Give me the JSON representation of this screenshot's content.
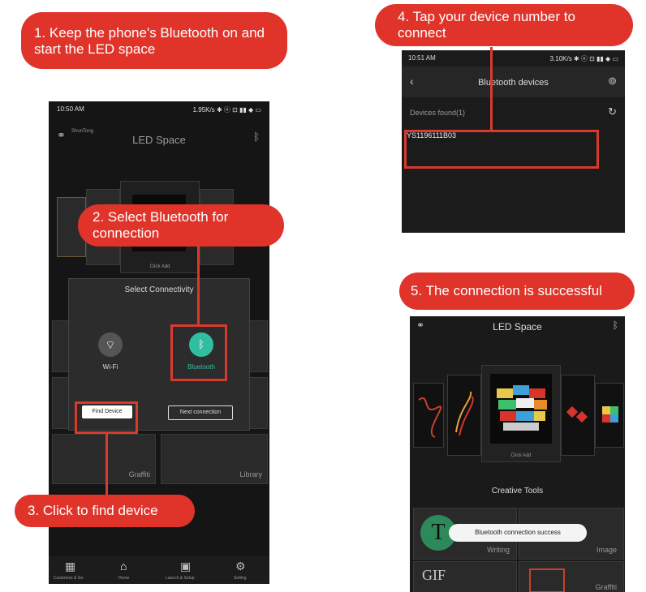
{
  "callouts": {
    "step1": "1. Keep the phone's Bluetooth on and start the LED space",
    "step2": "2. Select Bluetooth for connection",
    "step3": "3. Click to find device",
    "step4": "4. Tap your device number to connect",
    "step5": "5. The connection is successful"
  },
  "phone_left": {
    "status_time": "10:50 AM",
    "status_right": "1.95K/s ✱ ⓝ ⊡ ▮▮ ◆ ▭",
    "title": "LED Space",
    "partner_label": "ShunTong",
    "dialog_title": "Select Connectivity",
    "wifi_label": "Wi-Fi",
    "bluetooth_label": "Bluetooth",
    "find_device_button": "Find Device",
    "next_connection_button": "Next connection",
    "center_tile_caption": "Click Add",
    "graffiti_label": "Graffiti",
    "library_label": "Library",
    "tabbar": [
      "Customize & Go",
      "Home",
      "Launch & Setup",
      "Setting"
    ]
  },
  "phone_right_top": {
    "status_time": "10:51 AM",
    "status_right": "3.10K/s ✱ ⓝ ⊡ ▮▮ ◆ ▭",
    "title": "Bluetooth devices",
    "found_label": "Devices found(1)",
    "device_id": "YS1196111B03"
  },
  "phone_right_bottom": {
    "title": "LED Space",
    "center_caption": "Click Add",
    "section_title": "Creative Tools",
    "toast": "Bluetooth connection success",
    "writing_label": "Writing",
    "image_label": "Image",
    "graffiti_label": "Graffiti",
    "gif_label": "GIF"
  },
  "colors": {
    "accent_red": "#e0342b",
    "teal": "#2fbfa0",
    "phone_bg": "#151515"
  }
}
